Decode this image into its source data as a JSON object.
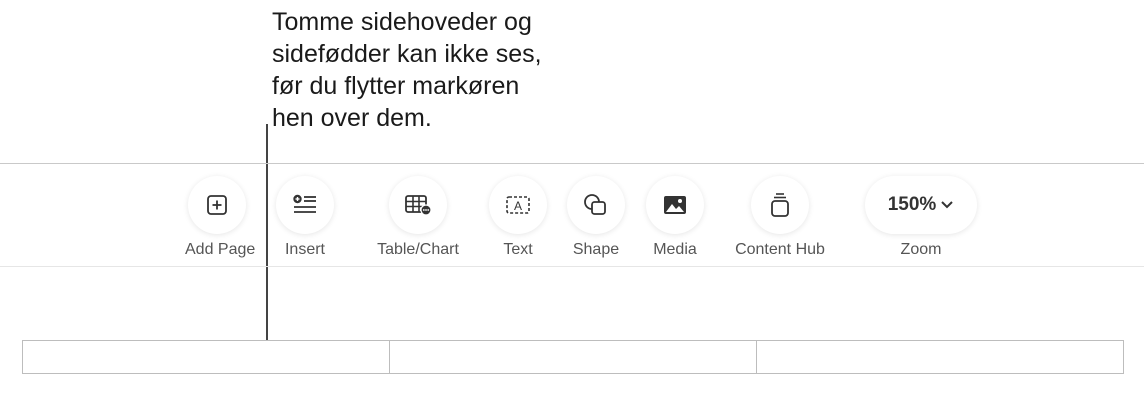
{
  "callout": {
    "text": "Tomme sidehoveder og\nsidefødder kan ikke ses,\nfør du flytter markøren\nhen over dem."
  },
  "toolbar": {
    "add_page": {
      "label": "Add Page",
      "icon": "plus-square-icon"
    },
    "insert": {
      "label": "Insert",
      "icon": "insert-list-icon"
    },
    "table_chart": {
      "label": "Table/Chart",
      "icon": "table-icon"
    },
    "text": {
      "label": "Text",
      "icon": "text-box-icon"
    },
    "shape": {
      "label": "Shape",
      "icon": "shape-icon"
    },
    "media": {
      "label": "Media",
      "icon": "photo-icon"
    },
    "content_hub": {
      "label": "Content Hub",
      "icon": "content-hub-icon"
    },
    "zoom": {
      "label": "Zoom",
      "value": "150%",
      "icon": "chevron-down-icon"
    }
  },
  "header_footer": {
    "cells": [
      "",
      "",
      ""
    ]
  }
}
